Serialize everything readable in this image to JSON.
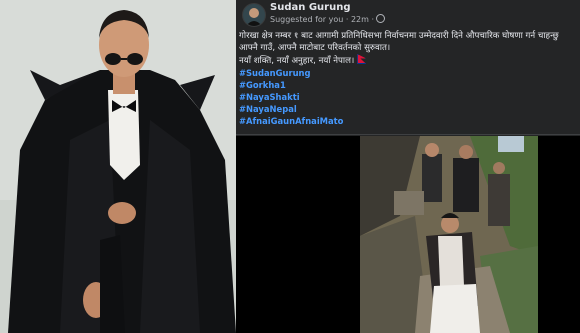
{
  "post": {
    "author": "Sudan Gurung",
    "meta": "Suggested for you · 22m ·",
    "text_lines": [
      "गोरखा क्षेत्र नम्बर १ बाट आगामी प्रतिनिधिसभा निर्वाचनमा उम्मेदवारी दिने औपचारिक घोषणा गर्न चाहन्छु",
      "आफ्नै गाउँ, आफ्नै माटोबाट परिवर्तनको सुरुवात।",
      "नयाँ शक्ति, नयाँ अनुहार, नयाँ नेपाल।"
    ],
    "hashtags": [
      "#SudanGurung",
      "#Gorkha1",
      "#NayaShakti",
      "#NayaNepal",
      "#AfnaiGaunAfnaiMato"
    ]
  },
  "icons": {
    "avatar": "profile-avatar",
    "globe": "globe-icon",
    "flag": "nepal-flag-emoji"
  },
  "colors": {
    "background": "#242526",
    "text": "#e4e6eb",
    "secondary_text": "#b0b3b8",
    "hashtag": "#4599ff"
  }
}
